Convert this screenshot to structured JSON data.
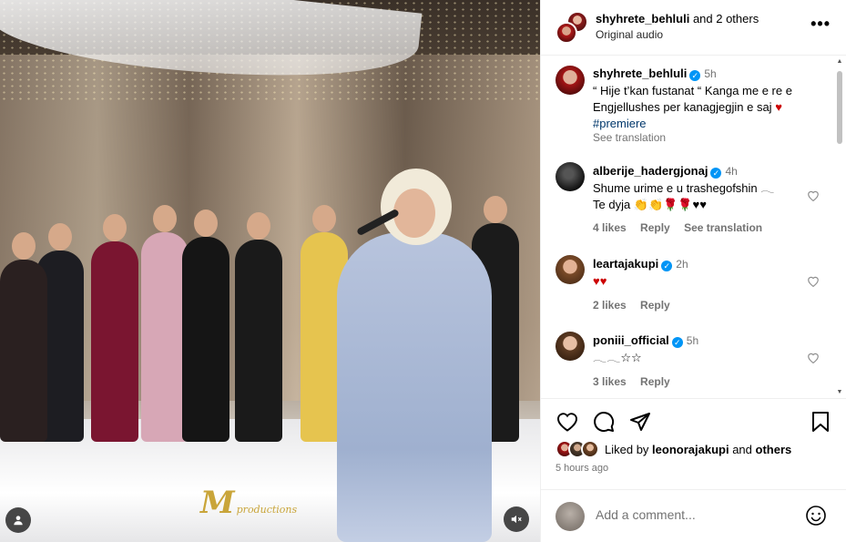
{
  "post": {
    "header": {
      "username": "shyhrete_behluli",
      "collab_suffix": "and 2 others",
      "audio": "Original audio"
    }
  },
  "media": {
    "watermark": "M",
    "watermark_sub": "productions"
  },
  "comments": [
    {
      "username": "shyhrete_behluli",
      "verified": true,
      "time": "5h",
      "text_line1": "“ Hije t’kan fustanat “ Kanga me e re e",
      "text_line2": "Engjellushes per kanagjegjin e saj",
      "text_line2_emoji": "♥",
      "hashtag": "#premiere",
      "see_translation": "See translation"
    },
    {
      "username": "alberije_hadergjonaj",
      "verified": true,
      "time": "4h",
      "text_line1": "Shume urime e u trashegofshin 𓂃",
      "text_line2": "Te dyja 👏👏🌹🌹♥♥",
      "likes": "4 likes",
      "reply": "Reply",
      "see_translation": "See translation"
    },
    {
      "username": "leartajakupi",
      "verified": true,
      "time": "2h",
      "text_line1": "♥♥",
      "likes": "2 likes",
      "reply": "Reply"
    },
    {
      "username": "poniii_official",
      "verified": true,
      "time": "5h",
      "text_line1": "𓂃𓂃☆☆",
      "likes": "3 likes",
      "reply": "Reply"
    }
  ],
  "actions": {
    "liked_prefix": "Liked by",
    "liked_user": "leonorajakupi",
    "liked_and": "and",
    "liked_others": "others",
    "time_ago": "5 hours ago"
  },
  "add_comment": {
    "placeholder": "Add a comment..."
  },
  "icons": {
    "more": "more-icon",
    "like": "heart-icon",
    "comment": "comment-icon",
    "share": "share-icon",
    "save": "bookmark-icon",
    "emoji": "emoji-icon",
    "mute": "mute-icon",
    "tag": "user-tag-icon"
  },
  "colors": {
    "link": "#00376b",
    "verified": "#0095f6",
    "muted_text": "#737373",
    "heart_red": "#c00000"
  }
}
